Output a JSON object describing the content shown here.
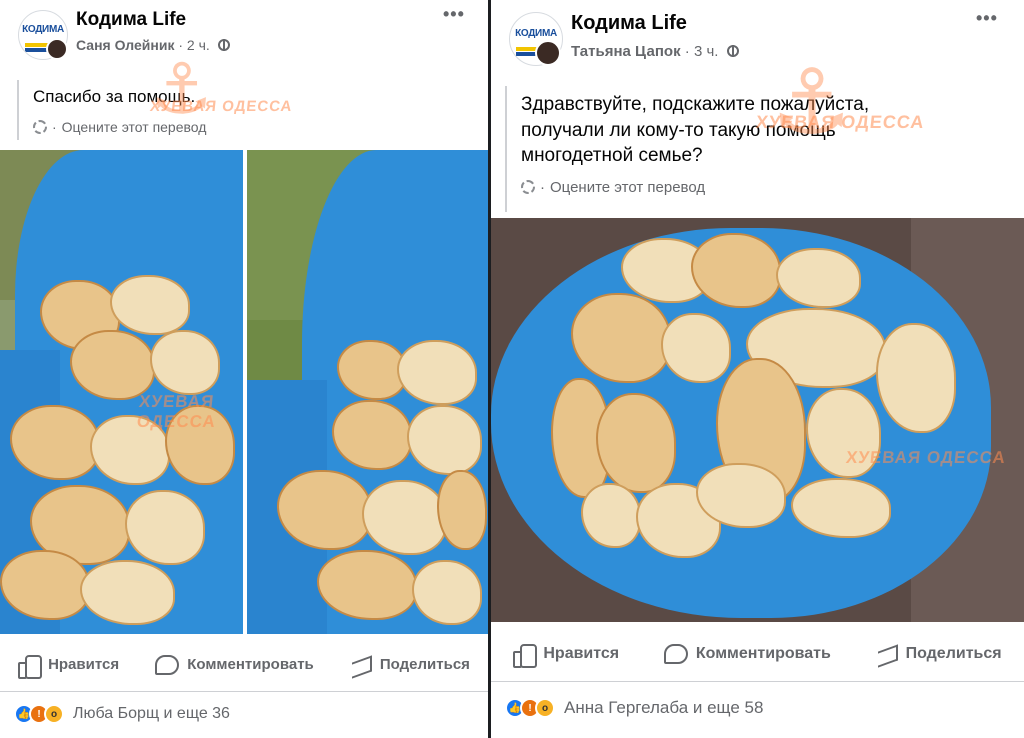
{
  "left_post": {
    "group_name": "Кодима Life",
    "avatar_logo": "КОДИМА",
    "author": "Саня Олейник",
    "time": "2 ч.",
    "more": "•••",
    "text": "Спасибо за помощь.",
    "translate_label": "Оцените этот перевод",
    "watermarks": [
      "ХУЕВАЯ ОДЕССА",
      "ХУЕВАЯ ОДЕССА"
    ],
    "actions": {
      "like": "Нравится",
      "comment": "Комментировать",
      "share": "Поделиться"
    },
    "reactions": {
      "names": "Люба Борщ и еще 36"
    }
  },
  "right_post": {
    "group_name": "Кодима Life",
    "avatar_logo": "КОДИМА",
    "author": "Татьяна Цапок",
    "time": "3 ч.",
    "more": "•••",
    "text_lines": [
      "Здравствуйте, подскажите пожалуйста,",
      "получали ли кому-то такую помощь",
      "многодетной семье?"
    ],
    "translate_label": "Оцените этот перевод",
    "watermarks": [
      "ХУЕВАЯ ОДЕССА",
      "ХУЕВАЯ ОДЕССА"
    ],
    "actions": {
      "like": "Нравится",
      "comment": "Комментировать",
      "share": "Поделиться"
    },
    "reactions": {
      "names": "Анна Гергелаба и еще 58"
    }
  },
  "colors": {
    "bag_blue": "#2f8ed8",
    "fb_blue": "#1877f2",
    "text_secondary": "#65676b"
  }
}
